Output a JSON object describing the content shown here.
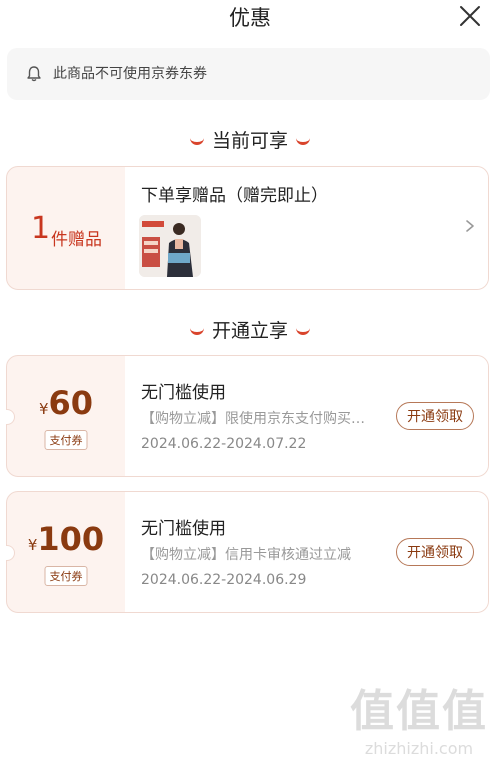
{
  "header": {
    "title": "优惠",
    "close_icon": "close-icon"
  },
  "notice": {
    "icon": "bell-icon",
    "text": "此商品不可使用京券东券"
  },
  "sections": {
    "current": {
      "title": "当前可享"
    },
    "open": {
      "title": "开通立享"
    }
  },
  "gift": {
    "count": "1",
    "unit": "件赠品",
    "title": "下单享赠品（赠完即止）",
    "thumb": "gift-product-image",
    "chevron": "chevron-right-icon"
  },
  "coupons": [
    {
      "currency": "¥",
      "amount": "60",
      "badge": "支付券",
      "title": "无门槛使用",
      "desc": "【购物立减】限使用京东支付购买指定商品",
      "date": "2024.06.22-2024.07.22",
      "button": "开通领取"
    },
    {
      "currency": "¥",
      "amount": "100",
      "badge": "支付券",
      "title": "无门槛使用",
      "desc": "【购物立减】信用卡审核通过立减",
      "date": "2024.06.22-2024.06.29",
      "button": "开通领取"
    }
  ],
  "watermark": {
    "big": "值值值",
    "small": "zhizhizhi.com"
  },
  "colors": {
    "accent": "#c8361f",
    "coupon_brown": "#8a3a10",
    "card_bg": "#fdf3ef"
  }
}
